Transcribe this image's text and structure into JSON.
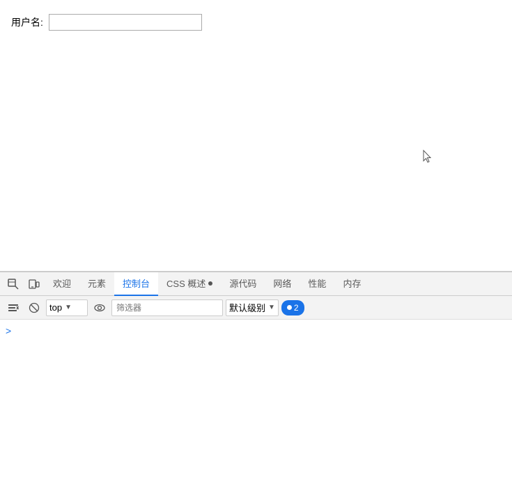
{
  "main": {
    "username_label": "用户名:",
    "username_placeholder": ""
  },
  "devtools": {
    "tabs": [
      {
        "id": "welcome",
        "label": "欢迎",
        "active": false
      },
      {
        "id": "elements",
        "label": "元素",
        "active": false
      },
      {
        "id": "console",
        "label": "控制台",
        "active": true
      },
      {
        "id": "css_overview",
        "label": "CSS 概述",
        "active": false,
        "has_dot": true
      },
      {
        "id": "sources",
        "label": "源代码",
        "active": false
      },
      {
        "id": "network",
        "label": "网络",
        "active": false
      },
      {
        "id": "performance",
        "label": "性能",
        "active": false
      },
      {
        "id": "memory",
        "label": "内存",
        "active": false
      }
    ],
    "toolbar": {
      "clear_label": "清除",
      "block_label": "阻止",
      "context_value": "top",
      "filter_placeholder": "筛选器",
      "log_level_label": "默认级别",
      "message_count": "2"
    },
    "console_prompt": ">"
  }
}
